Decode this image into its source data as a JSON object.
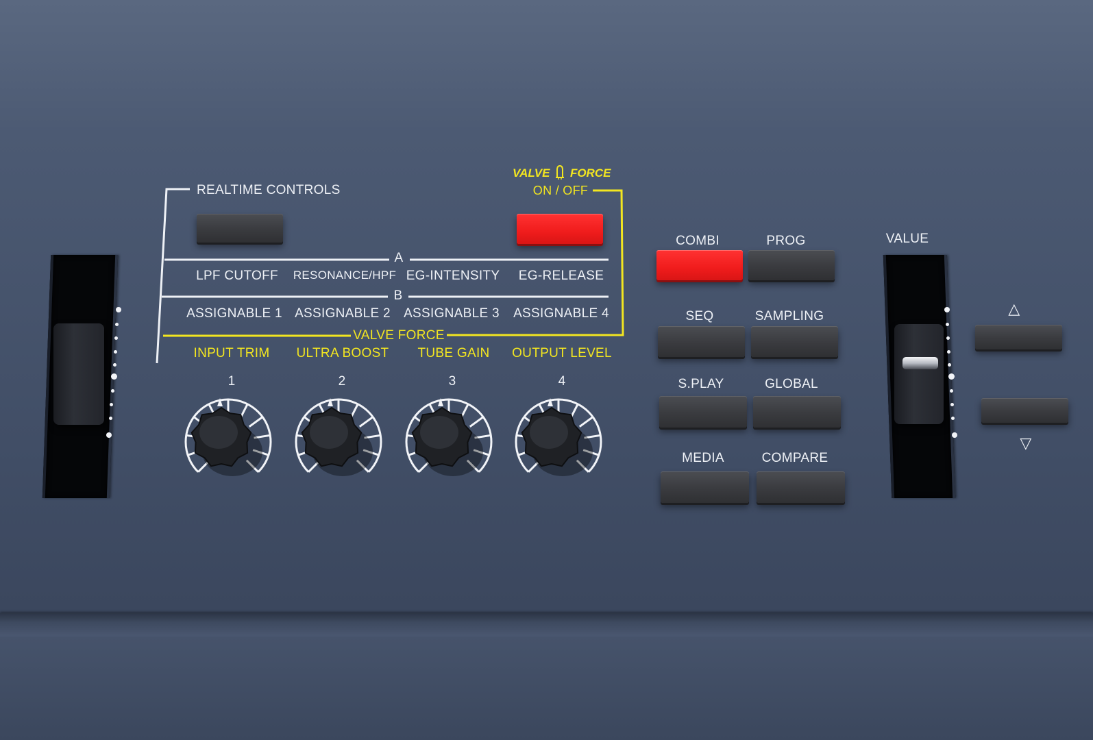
{
  "realtime": {
    "title": "REALTIME CONTROLS",
    "row_a_marker": "A",
    "row_b_marker": "B",
    "row_a": [
      "LPF CUTOFF",
      "RESONANCE/HPF",
      "EG-INTENSITY",
      "EG-RELEASE"
    ],
    "row_b": [
      "ASSIGNABLE 1",
      "ASSIGNABLE 2",
      "ASSIGNABLE 3",
      "ASSIGNABLE 4"
    ]
  },
  "valve_force": {
    "logo_left": "VALVE",
    "logo_right": "FORCE",
    "on_off": "ON / OFF",
    "section": "VALVE FORCE",
    "labels": [
      "INPUT TRIM",
      "ULTRA BOOST",
      "TUBE GAIN",
      "OUTPUT LEVEL"
    ],
    "state": "on"
  },
  "knobs": [
    {
      "number": "1"
    },
    {
      "number": "2"
    },
    {
      "number": "3"
    },
    {
      "number": "4"
    }
  ],
  "modes": {
    "combi": "COMBI",
    "prog": "PROG",
    "seq": "SEQ",
    "sampling": "SAMPLING",
    "splay": "S.PLAY",
    "global": "GLOBAL",
    "media": "MEDIA",
    "compare": "COMPARE",
    "active": "COMBI"
  },
  "value": {
    "label": "VALUE",
    "up_symbol": "△",
    "down_symbol": "▽"
  },
  "colors": {
    "panel": "#46536b",
    "label_white": "#eef1f6",
    "label_yellow": "#f3e620",
    "led_red": "#f01c1c",
    "key_dark": "#3a3b3f"
  }
}
